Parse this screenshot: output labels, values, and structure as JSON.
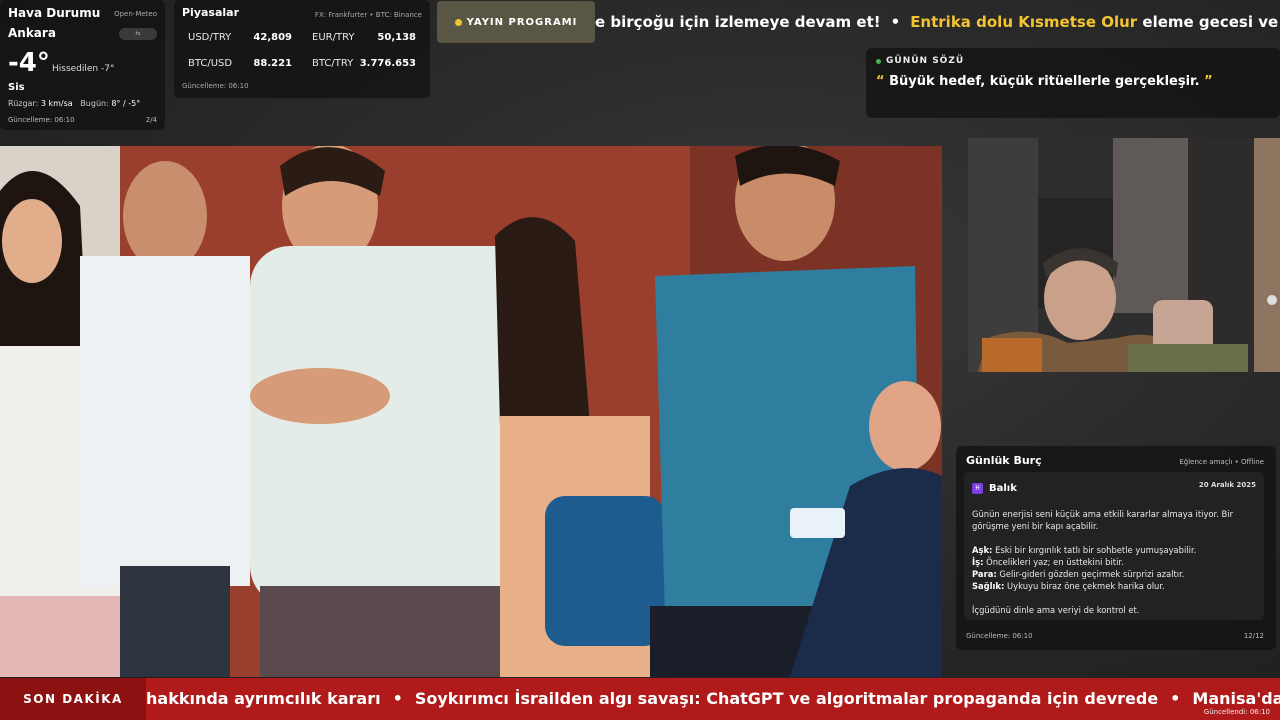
{
  "weather": {
    "title": "Hava Durumu",
    "source": "Open-Meteo",
    "city": "Ankara",
    "pill": "⇆",
    "temperature": "-4°",
    "feels_like": "Hissedilen -7°",
    "condition": "Sis",
    "wind_label": "Rüzgar:",
    "wind_value": "3 km/sa",
    "today_label": "Bugün:",
    "today_value": "8° / -5°",
    "updated": "Güncelleme: 06:10",
    "page": "2/4"
  },
  "markets": {
    "title": "Piyasalar",
    "source": "FX: Frankfurter • BTC: Binance",
    "items": [
      {
        "label": "USD/TRY",
        "value": "42,809"
      },
      {
        "label": "EUR/TRY",
        "value": "50,138"
      },
      {
        "label": "BTC/USD",
        "value": "88.221"
      },
      {
        "label": "BTC/TRY",
        "value": "3.776.653"
      }
    ],
    "updated": "Güncelleme: 06:10"
  },
  "schedule": {
    "label": "YAYIN PROGRAMI"
  },
  "top_ticker": {
    "part1": "e birçoğu için izlemeye devam et!",
    "sep": "•",
    "highlight": "Entrika dolu Kısmetse Olur",
    "part2": "eleme gecesi ve ilişki u"
  },
  "quote": {
    "title": "GÜNÜN SÖZÜ",
    "open_mark": "“",
    "text": "Büyük hedef, küçük ritüellerle gerçekleşir.",
    "close_mark": "”"
  },
  "horoscope": {
    "title": "Günlük Burç",
    "mode": "Eğlence amaçlı • Offline",
    "sign_icon": "♓",
    "sign": "Balık",
    "date": "20 Aralık 2025",
    "intro": "Günün enerjisi seni küçük ama etkili kararlar almaya itiyor. Bir görüşme yeni bir kapı açabilir.",
    "love_label": "Aşk:",
    "love": "Eski bir kırgınlık tatlı bir sohbetle yumuşayabilir.",
    "work_label": "İş:",
    "work": "Öncelikleri yaz; en üsttekini bitir.",
    "money_label": "Para:",
    "money": "Gelir-gideri gözden geçirmek sürprizi azaltır.",
    "health_label": "Sağlık:",
    "health": "Uykuyu biraz öne çekmek harika olur.",
    "outro": "İçgüdünü dinle ama veriyi de kontrol et.",
    "updated": "Güncelleme: 06:10",
    "page": "12/12"
  },
  "breaking": {
    "label": "SON DAKİKA",
    "items": [
      "hakkında ayrımcılık kararı",
      "Soykırımcı İsrailden algı savaşı: ChatGPT ve algoritmalar propaganda için devrede",
      "Manisa'da piy"
    ],
    "sep": "•",
    "corner_updated": "Güncellendi: 06:10"
  },
  "colors": {
    "accent": "#f4c430",
    "breaking_bg": "#b01a1a",
    "live_dot": "#4caf50"
  }
}
